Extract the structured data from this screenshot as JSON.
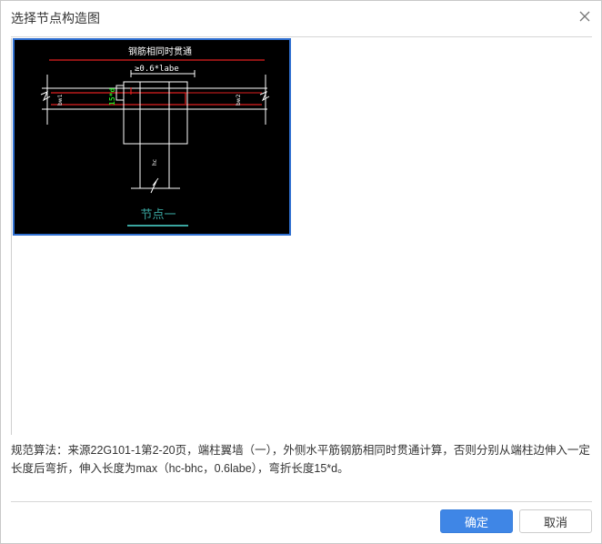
{
  "dialog": {
    "title": "选择节点构造图",
    "close_icon": "close-icon"
  },
  "thumbnails": [
    {
      "caption": "节点一",
      "selected": true,
      "drawing": {
        "heading": "钢筋相同时贯通",
        "dim_label": "≥0.6*labe",
        "bend_label": "15*d",
        "left_wall_label": "bw1",
        "right_wall_label": "bw2",
        "column_label": "hc"
      }
    }
  ],
  "description": "规范算法：来源22G101-1第2-20页，端柱翼墙（一），外侧水平筋钢筋相同时贯通计算，否则分别从端柱边伸入一定长度后弯折，伸入长度为max（hc-bhc，0.6labe），弯折长度15*d。",
  "buttons": {
    "ok": "确定",
    "cancel": "取消"
  },
  "colors": {
    "accent": "#3f86e6",
    "selection_border": "#2f6fd0",
    "drawing_bg": "#000000",
    "rebar_red": "#e02020",
    "bend_green": "#22dd22",
    "caption_teal": "#3aa6a0"
  }
}
